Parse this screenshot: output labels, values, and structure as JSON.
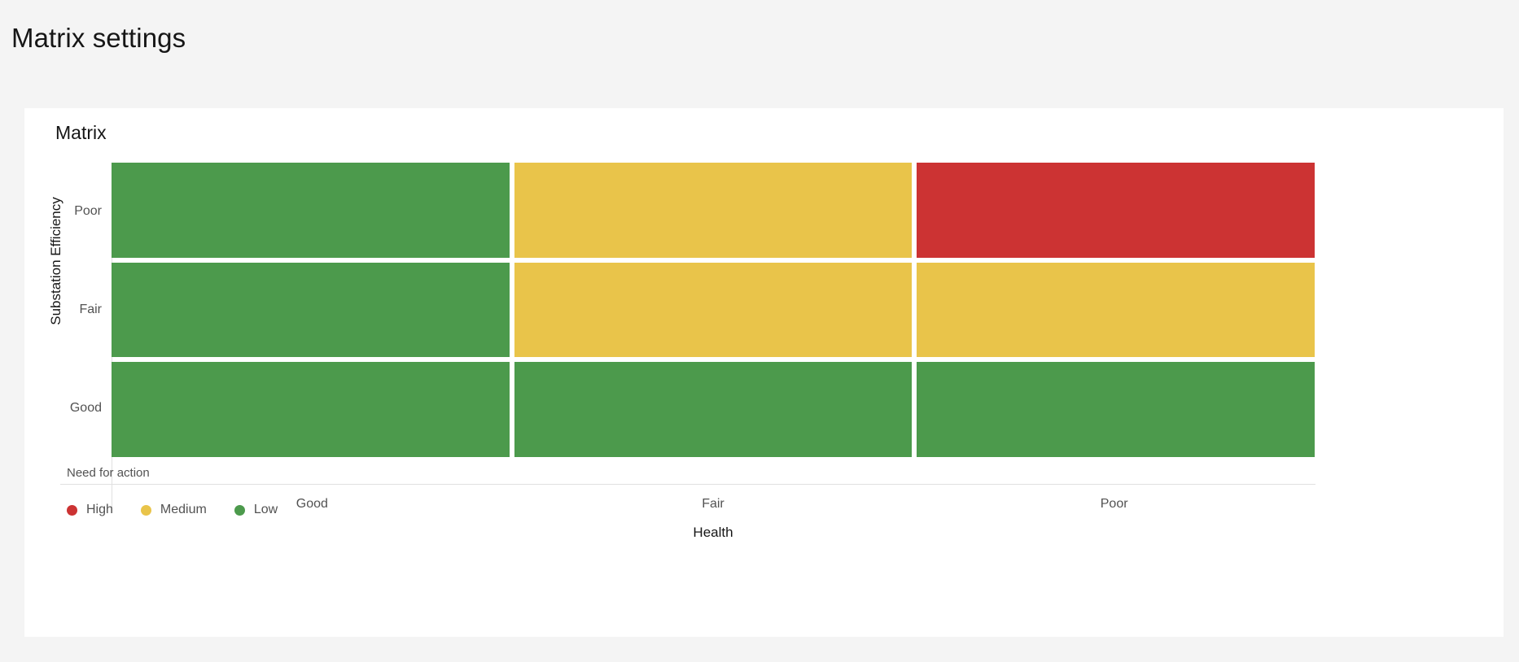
{
  "page": {
    "title": "Matrix settings",
    "background": "#f4f4f4"
  },
  "card": {
    "title": "Matrix"
  },
  "chart_data": {
    "type": "heatmap",
    "title": "Matrix",
    "xlabel": "Health",
    "ylabel": "Substation Efficiency",
    "x_categories": [
      "Good",
      "Fair",
      "Poor"
    ],
    "y_categories": [
      "Poor",
      "Fair",
      "Good"
    ],
    "grid": false,
    "legend_position": "bottom-left",
    "legend_title": "Need for action",
    "legend": [
      {
        "label": "High",
        "color": "#cc3333"
      },
      {
        "label": "Medium",
        "color": "#e9c44a"
      },
      {
        "label": "Low",
        "color": "#4c9a4c"
      }
    ],
    "colors": {
      "high": "#cc3333",
      "medium": "#e9c44a",
      "low": "#4c9a4c"
    },
    "cells": [
      {
        "row": "Poor",
        "col": "Good",
        "value": "Low",
        "color": "#4c9a4c"
      },
      {
        "row": "Poor",
        "col": "Fair",
        "value": "Medium",
        "color": "#e9c44a"
      },
      {
        "row": "Poor",
        "col": "Poor",
        "value": "High",
        "color": "#cc3333"
      },
      {
        "row": "Fair",
        "col": "Good",
        "value": "Low",
        "color": "#4c9a4c"
      },
      {
        "row": "Fair",
        "col": "Fair",
        "value": "Medium",
        "color": "#e9c44a"
      },
      {
        "row": "Fair",
        "col": "Poor",
        "value": "Medium",
        "color": "#e9c44a"
      },
      {
        "row": "Good",
        "col": "Good",
        "value": "Low",
        "color": "#4c9a4c"
      },
      {
        "row": "Good",
        "col": "Fair",
        "value": "Low",
        "color": "#4c9a4c"
      },
      {
        "row": "Good",
        "col": "Poor",
        "value": "Low",
        "color": "#4c9a4c"
      }
    ]
  }
}
